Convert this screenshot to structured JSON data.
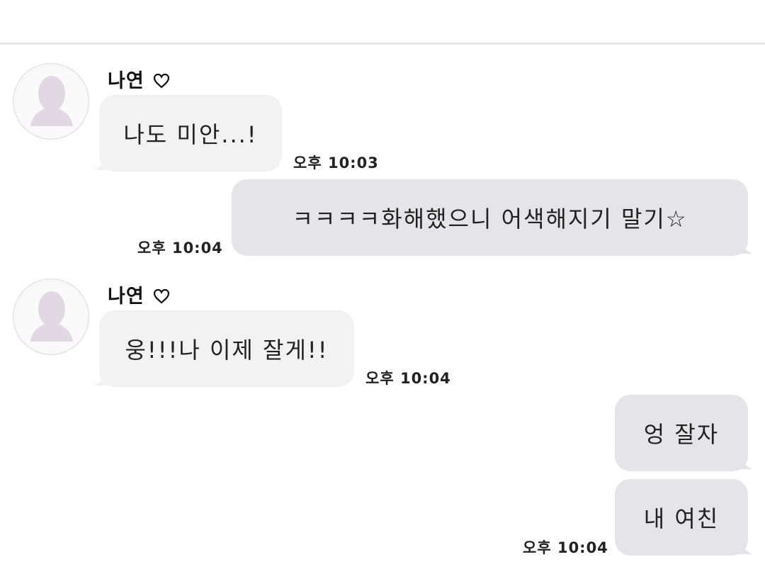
{
  "colors": {
    "incoming_bubble": "#f2f2f3",
    "outgoing_bubble": "#e7e4e9",
    "avatar_silhouette": "#e2d8e4"
  },
  "messages": [
    {
      "direction": "in",
      "sender": "나연",
      "sender_icon": "heart-outline-icon",
      "text": "나도 미안...!",
      "time": "오후 10:03"
    },
    {
      "direction": "out",
      "text": "ㅋㅋㅋㅋ화해했으니 어색해지기 말기☆",
      "time": "오후 10:04"
    },
    {
      "direction": "in",
      "sender": "나연",
      "sender_icon": "heart-outline-icon",
      "text": "웅!!!나 이제 잘게!!",
      "time": "오후 10:04"
    },
    {
      "direction": "out",
      "text": "엉 잘자",
      "time": ""
    },
    {
      "direction": "out",
      "text": "내 여친",
      "time": "오후 10:04"
    }
  ]
}
